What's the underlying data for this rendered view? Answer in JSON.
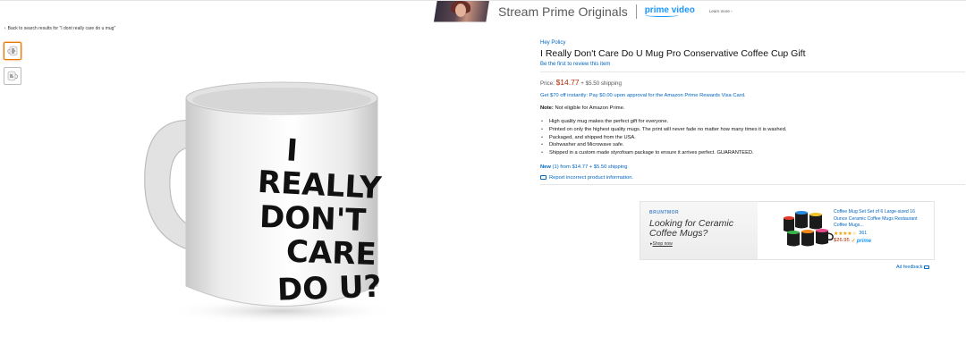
{
  "banner": {
    "title": "Stream Prime Originals",
    "logo": "prime video",
    "learn_more": "Learn more ›"
  },
  "back_link": "Back to search results for \"I dont really care do u mug\"",
  "thumbnails": [
    {
      "icon": "mug-front-thumbnail",
      "selected": true
    },
    {
      "icon": "mug-side-thumbnail",
      "selected": false
    }
  ],
  "product": {
    "brand": "Hey Policy",
    "title": "I Really Don't Care Do U Mug Pro Conservative Coffee Cup Gift",
    "review_link": "Be the first to review this item",
    "price_label": "Price:",
    "price": "$14.77",
    "shipping": "+ $5.50 shipping",
    "promo": "Get $70 off instantly: Pay $0.00 upon approval for the Amazon Prime Rewards Visa Card.",
    "note_label": "Note:",
    "note_text": "Not eligible for Amazon Prime.",
    "bullets": [
      "High quality mug makes the perfect gift for everyone.",
      "Printed on only the highest quality mugs. The print will never fade no matter how many times it is washed.",
      "Packaged, and shipped from the USA.",
      "Dishwasher and Microwave safe.",
      "Shipped in a custom made styrofoam package to ensure it arrives perfect. GUARANTEED."
    ],
    "new_label": "New",
    "new_offers": "(1) from $14.77 + $5.50 shipping",
    "report_link": "Report incorrect product information.",
    "mug_print": [
      "I",
      "REALLY",
      "DON'T",
      "CARE",
      "DO U?"
    ]
  },
  "ad": {
    "brand": "BRUNTMOR",
    "headline": "Looking for Ceramic Coffee Mugs?",
    "shop_now": "Shop now",
    "product_title": "Coffee Mug Set Set of 6 Large-sized 16 Ounce Ceramic Coffee Mugs Restaurant Coffee Mugs...",
    "rating": 4.5,
    "stars": "★★★★☆",
    "review_count": "361",
    "price": "$26.95",
    "prime": "prime",
    "feedback": "Ad feedback"
  },
  "colors": {
    "link": "#0066c0",
    "price": "#b12704",
    "prime_blue": "#1a98ff",
    "selected_thumb": "#e77600"
  }
}
